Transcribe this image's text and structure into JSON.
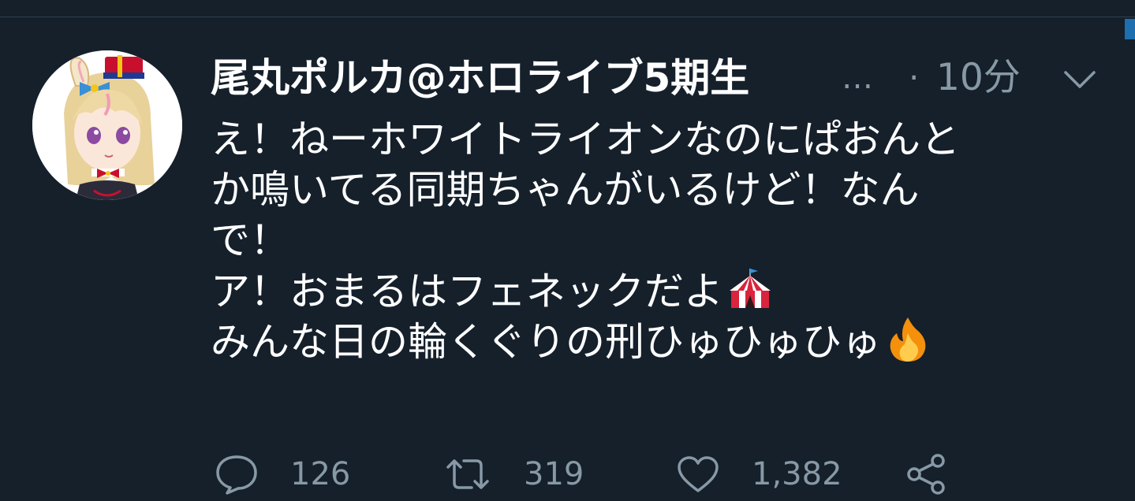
{
  "tweet": {
    "author": {
      "display_name": "尾丸ポルカ@ホロライブ5期生",
      "truncation": "…"
    },
    "separator": "·",
    "timestamp": "10分",
    "text_lines": [
      "え！ねーホワイトライオンなのにぱおんと",
      "か鳴いてる同期ちゃんがいるけど！なん",
      "で！",
      "ア！おまるはフェネックだよ",
      "みんな日の輪くぐりの刑ひゅひゅひゅ"
    ],
    "emojis": [
      "circus-tent-icon",
      "fire-icon"
    ],
    "actions": {
      "reply_count": "126",
      "retweet_count": "319",
      "like_count": "1,382"
    }
  },
  "colors": {
    "background": "#15202b",
    "text_primary": "#ffffff",
    "text_secondary": "#8899a6",
    "accent": "#1d6fb0"
  }
}
